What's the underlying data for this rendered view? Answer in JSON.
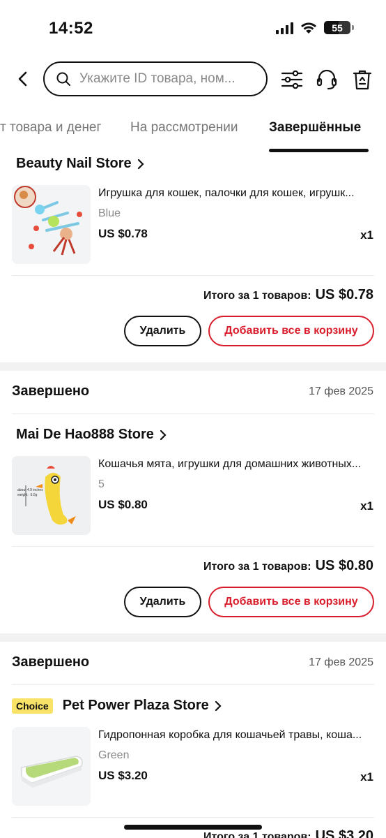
{
  "status_bar": {
    "time": "14:52",
    "battery": "55"
  },
  "header": {
    "search_placeholder": "Укажите ID товара, ном..."
  },
  "tabs": [
    {
      "label": "т товара и денег"
    },
    {
      "label": "На рассмотрении"
    },
    {
      "label": "Завершённые"
    }
  ],
  "orders": [
    {
      "store": "Beauty Nail Store",
      "product_name": "Игрушка для кошек, палочки для кошек, игрушк...",
      "variant": "Blue",
      "price": "US $0.78",
      "qty": "x1",
      "total_label": "Итого за 1 товаров:",
      "total_value": "US $0.78",
      "delete_label": "Удалить",
      "cart_label": "Добавить все в корзину"
    },
    {
      "status": "Завершено",
      "date": "17 фев 2025",
      "store": "Mai De Hao888 Store",
      "product_name": "Кошачья мята, игрушки для домашних животных...",
      "variant": "5",
      "price": "US $0.80",
      "qty": "x1",
      "total_label": "Итого за 1 товаров:",
      "total_value": "US $0.80",
      "delete_label": "Удалить",
      "cart_label": "Добавить все в корзину"
    },
    {
      "status": "Завершено",
      "date": "17 фев 2025",
      "badge": "Choice",
      "store": "Pet Power Plaza Store",
      "product_name": "Гидропонная коробка для кошачьей травы, коша...",
      "variant": "Green",
      "price": "US $3.20",
      "qty": "x1",
      "total_label": "Итого за 1 товаров:",
      "total_value": "US $3.20"
    }
  ],
  "colors": {
    "accent": "#d81e2b",
    "badge": "#f8e267"
  }
}
